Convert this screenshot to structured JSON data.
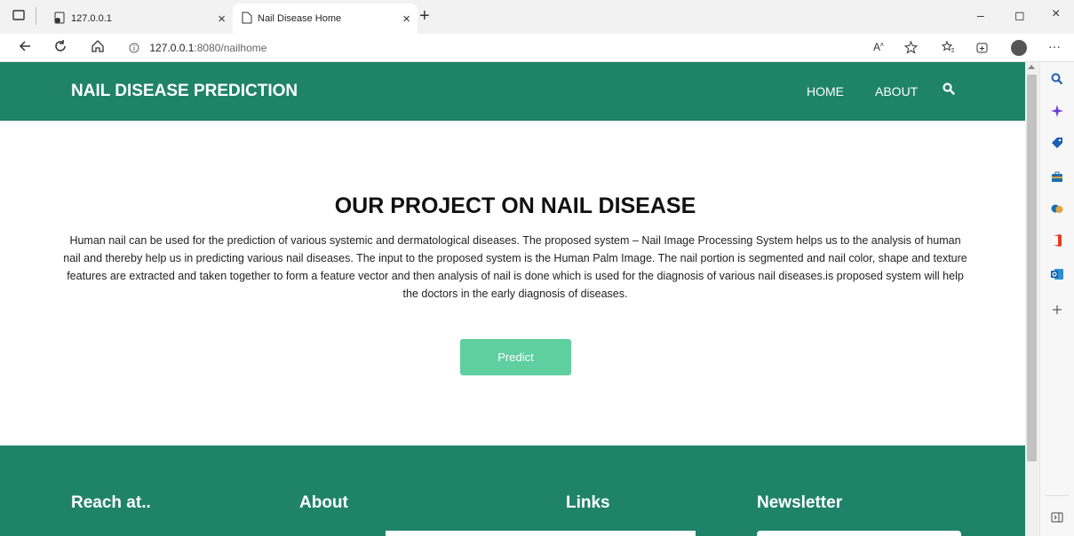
{
  "browser": {
    "tabs": [
      {
        "title": "127.0.0.1",
        "close": "×"
      },
      {
        "title": "Nail Disease Home",
        "close": "×"
      }
    ],
    "new_tab": "+",
    "window_controls": {
      "minimize": "–",
      "restore": "◻",
      "close": "×"
    },
    "address": {
      "host": "127.0.0.1",
      "path": ":8080/nailhome"
    },
    "more": "···"
  },
  "site": {
    "brand": "NAIL DISEASE PREDICTION",
    "nav": {
      "home": "HOME",
      "about": "ABOUT"
    },
    "hero": {
      "title": "OUR PROJECT ON NAIL DISEASE",
      "body": "Human nail can be used for the prediction of various systemic and dermatological diseases. The proposed system – Nail Image Processing System helps us to the analysis of human nail and thereby help us in predicting various nail diseases. The input to the proposed system is the Human Palm Image. The nail portion is segmented and nail color, shape and texture features are extracted and taken together to form a feature vector and then analysis of nail is done which is used for the diagnosis of various nail diseases.is proposed system will help the doctors in the early diagnosis of diseases.",
      "predict_label": "Predict"
    },
    "footer": {
      "reach": "Reach at..",
      "about": "About",
      "links": "Links",
      "newsletter": "Newsletter"
    }
  },
  "colors": {
    "primary": "#1f8369",
    "button": "#5fcfa0"
  },
  "sidebar_icons": [
    "search-icon",
    "sparkle-icon",
    "tag-icon",
    "briefcase-icon",
    "games-icon",
    "office-icon",
    "outlook-icon",
    "plus-icon"
  ]
}
